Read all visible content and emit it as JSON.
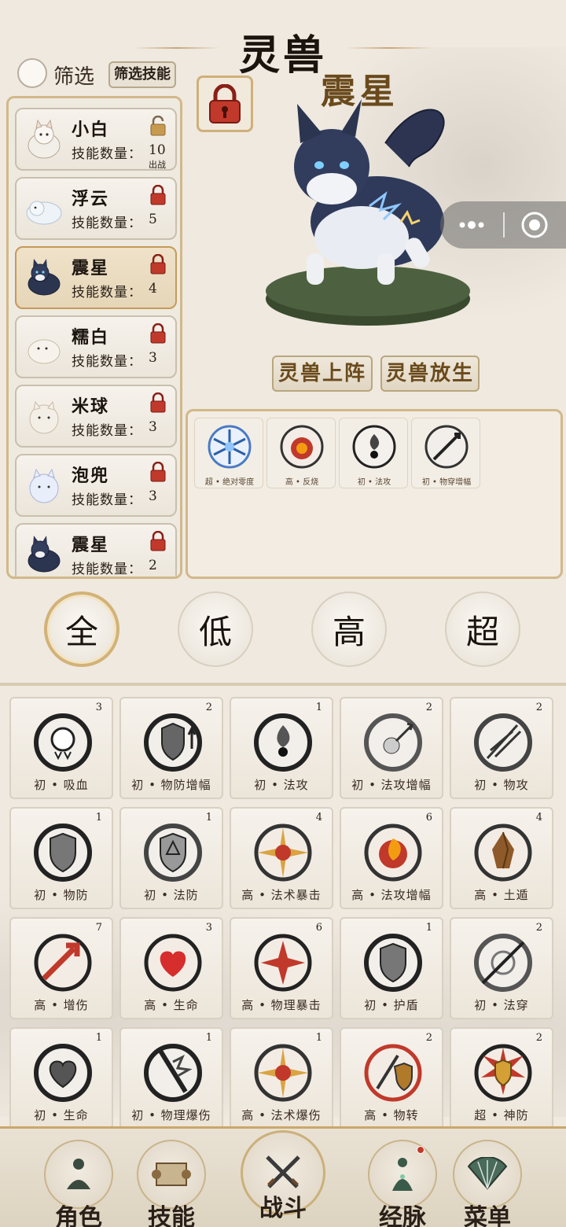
{
  "header": {
    "title": "灵兽",
    "selected_beast": "震星"
  },
  "filter": {
    "label": "筛选",
    "skill_filter_button": "筛选技能"
  },
  "beasts": [
    {
      "name": "小白",
      "count_label": "技能数量：",
      "count": "10",
      "status": "出战",
      "locked": false
    },
    {
      "name": "浮云",
      "count_label": "技能数量：",
      "count": "5",
      "locked": true
    },
    {
      "name": "震星",
      "count_label": "技能数量：",
      "count": "4",
      "locked": true,
      "active": true
    },
    {
      "name": "糯白",
      "count_label": "技能数量：",
      "count": "3",
      "locked": true
    },
    {
      "name": "米球",
      "count_label": "技能数量：",
      "count": "3",
      "locked": true
    },
    {
      "name": "泡兜",
      "count_label": "技能数量：",
      "count": "3",
      "locked": true
    },
    {
      "name": "震星",
      "count_label": "技能数量：",
      "count": "2",
      "locked": true
    }
  ],
  "actions": {
    "deploy": "灵兽上阵",
    "release": "灵兽放生"
  },
  "equipped_skills": [
    "超 • 绝对零度",
    "高 • 反烧",
    "初 • 法攻",
    "初 • 物穿增幅"
  ],
  "tiers": [
    "全",
    "低",
    "高",
    "超"
  ],
  "skills": [
    {
      "label": "初 • 吸血",
      "count": "3",
      "icon": "fangs-icon",
      "accent": "#222222"
    },
    {
      "label": "初 • 物防增幅",
      "count": "2",
      "icon": "shield-up-icon",
      "accent": "#333333"
    },
    {
      "label": "初 • 法攻",
      "count": "1",
      "icon": "flame-orb-icon",
      "accent": "#222222"
    },
    {
      "label": "初 • 法攻增幅",
      "count": "2",
      "icon": "orb-arrow-icon",
      "accent": "#555555"
    },
    {
      "label": "初 • 物攻",
      "count": "2",
      "icon": "blade-icon",
      "accent": "#444444"
    },
    {
      "label": "初 • 物防",
      "count": "1",
      "icon": "shield-icon",
      "accent": "#333333"
    },
    {
      "label": "初 • 法防",
      "count": "1",
      "icon": "magic-shield-icon",
      "accent": "#444444"
    },
    {
      "label": "高 • 法术暴击",
      "count": "4",
      "icon": "burst-orb-icon",
      "accent": "#c0392b"
    },
    {
      "label": "高 • 法攻增幅",
      "count": "6",
      "icon": "fire-orb-icon",
      "accent": "#d35400"
    },
    {
      "label": "高 • 土遁",
      "count": "4",
      "icon": "earth-icon",
      "accent": "#8e5a2a"
    },
    {
      "label": "高 • 增伤",
      "count": "7",
      "icon": "red-arrow-icon",
      "accent": "#c0392b"
    },
    {
      "label": "高 • 生命",
      "count": "3",
      "icon": "heart-icon",
      "accent": "#c0392b"
    },
    {
      "label": "高 • 物理暴击",
      "count": "6",
      "icon": "red-burst-icon",
      "accent": "#c0392b"
    },
    {
      "label": "初 • 护盾",
      "count": "1",
      "icon": "shield-icon",
      "accent": "#555555"
    },
    {
      "label": "初 • 法穿",
      "count": "2",
      "icon": "pierce-icon",
      "accent": "#555555"
    },
    {
      "label": "初 • 生命",
      "count": "1",
      "icon": "heart-outline-icon",
      "accent": "#333333"
    },
    {
      "label": "初 • 物理爆伤",
      "count": "1",
      "icon": "sword-burst-icon",
      "accent": "#333333"
    },
    {
      "label": "高 • 法术爆伤",
      "count": "1",
      "icon": "burst-orb-icon",
      "accent": "#c0392b"
    },
    {
      "label": "高 • 物转",
      "count": "2",
      "icon": "sword-shield-icon",
      "accent": "#c0392b"
    },
    {
      "label": "超 • 神防",
      "count": "2",
      "icon": "gold-shield-icon",
      "accent": "#b8860b"
    }
  ],
  "nav": [
    "角色",
    "技能",
    "战斗",
    "经脉",
    "菜单"
  ]
}
